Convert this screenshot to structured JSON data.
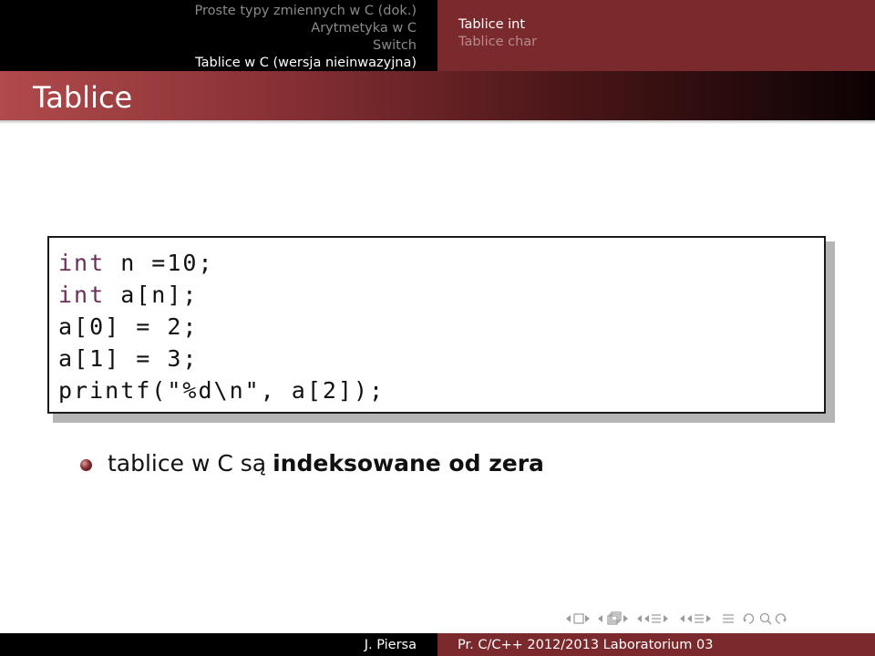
{
  "header": {
    "sections_left": [
      {
        "label": "Proste typy zmiennych w C (dok.)",
        "active": false
      },
      {
        "label": "Arytmetyka w C",
        "active": false
      },
      {
        "label": "Switch",
        "active": false
      },
      {
        "label": "Tablice w C (wersja nieinwazyjna)",
        "active": true
      }
    ],
    "subsections_right": [
      {
        "label": "Tablice int",
        "active": true
      },
      {
        "label": "Tablice char",
        "active": false
      }
    ]
  },
  "frame": {
    "title": "Tablice"
  },
  "code": {
    "lines": [
      {
        "kw": "int",
        "rest": " n =10;"
      },
      {
        "kw": "int",
        "rest": " a[n];"
      },
      {
        "kw": "",
        "rest": "a[0] = 2;"
      },
      {
        "kw": "",
        "rest": "a[1] = 3;"
      },
      {
        "kw": "",
        "rest": "printf(\"%d\\n\", a[2]);"
      }
    ]
  },
  "bullet": {
    "text_plain": "tablice w C są",
    "text_bold": "indeksowane od zera"
  },
  "footer": {
    "author": "J. Piersa",
    "course": "Pr. C/C++ 2012/2013 Laboratorium 03"
  },
  "colors": {
    "accent": "#7a2a2d",
    "keyword": "#6a2f5a",
    "dark": "#000000"
  }
}
